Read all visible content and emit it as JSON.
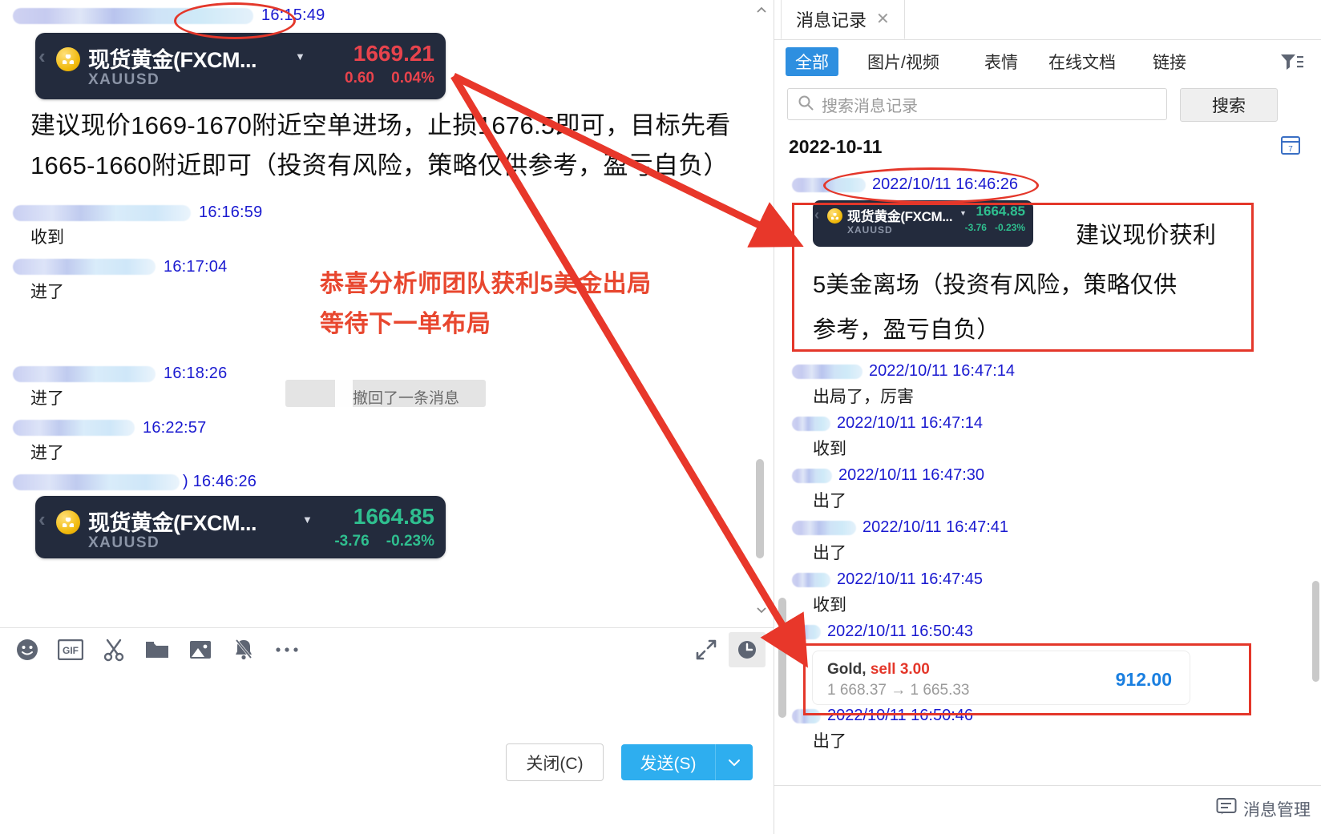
{
  "left": {
    "messages": [
      {
        "time": "16:15:49",
        "masked_width": 300,
        "type": "quote"
      },
      {
        "time": "16:16:59",
        "masked_width": 222,
        "text": "收到"
      },
      {
        "time": "16:17:04",
        "masked_width": 178,
        "text": "进了"
      },
      {
        "time": "16:18:26",
        "masked_width": 178,
        "text": "进了"
      },
      {
        "time": "16:22:57",
        "masked_width": 152,
        "text": "进了"
      },
      {
        "time": "16:46:26",
        "masked_width": 208,
        "type": "quote2"
      }
    ],
    "quote_top": {
      "name": "现货黄金(FXCM...",
      "symbol": "XAUUSD",
      "price": "1669.21",
      "change": "0.60",
      "change_pct": "0.04%",
      "direction": "up"
    },
    "quote_bottom": {
      "name": "现货黄金(FXCM...",
      "symbol": "XAUUSD",
      "price": "1664.85",
      "change": "-3.76",
      "change_pct": "-0.23%",
      "direction": "down"
    },
    "advice_text": "建议现价1669-1670附近空单进场，止损1676.5即可，目标先看1665-1660附近即可（投资有风险，策略仅供参考，盈亏自负）",
    "recall_text": "撤回了一条消息",
    "toolbar_icons": [
      "emoji-icon",
      "gif-icon",
      "scissors-icon",
      "folder-icon",
      "image-icon",
      "bell-muted-icon",
      "more-icon"
    ],
    "expand_icon": "expand-icon",
    "history_icon": "clock-icon",
    "close_label": "关闭(C)",
    "send_label": "发送(S)"
  },
  "right": {
    "tab_label": "消息记录",
    "tab_close_icon": "close-icon",
    "collapse_icon": "collapse-icon",
    "filters": [
      {
        "label": "全部",
        "active": true
      },
      {
        "label": "图片/视频",
        "active": false
      },
      {
        "label": "表情",
        "active": false
      },
      {
        "label": "在线文档",
        "active": false
      },
      {
        "label": "链接",
        "active": false
      }
    ],
    "filter_icon": "filter-icon",
    "search_placeholder": "搜索消息记录",
    "search_icon": "search-icon",
    "search_button": "搜索",
    "date_header": "2022-10-11",
    "calendar_icon": "calendar-icon",
    "quote": {
      "name": "现货黄金(FXCM...",
      "symbol": "XAUUSD",
      "price": "1664.85",
      "change": "-3.76",
      "change_pct": "-0.23%"
    },
    "highlight_line1": "建议现价获利",
    "highlight_line2": "5美金离场（投资有风险，策略仅供",
    "highlight_line3": "参考，盈亏自负）",
    "messages": [
      {
        "time": "2022/10/11 16:46:26",
        "masked_width": 92,
        "text": ""
      },
      {
        "time": "2022/10/11 16:47:14",
        "masked_width": 88,
        "text": "出局了，厉害"
      },
      {
        "time": "2022/10/11 16:47:14",
        "masked_width": 48,
        "text": "收到"
      },
      {
        "time": "2022/10/11 16:47:30",
        "masked_width": 50,
        "text": "出了"
      },
      {
        "time": "2022/10/11 16:47:41",
        "masked_width": 80,
        "text": "出了"
      },
      {
        "time": "2022/10/11 16:47:45",
        "masked_width": 48,
        "text": "收到"
      },
      {
        "time": "2022/10/11 16:50:43",
        "masked_width": 36,
        "text": ""
      },
      {
        "time": "2022/10/11 16:50:46",
        "masked_width": 36,
        "text": "出了"
      }
    ],
    "trade_card": {
      "instrument": "Gold,",
      "side": "sell 3.00",
      "prices": "1 668.37  →  1 665.33",
      "profit": "912.00"
    },
    "footer_label": "消息管理",
    "footer_icon": "message-manage-icon"
  },
  "annotations": {
    "red_note_line1": "恭喜分析师团队获利5美金出局",
    "red_note_line2": "等待下一单布局",
    "accent_red": "#e4372a",
    "note_red": "#e8472f",
    "link_blue": "#1a1ad0",
    "send_blue": "#2eaeef"
  }
}
